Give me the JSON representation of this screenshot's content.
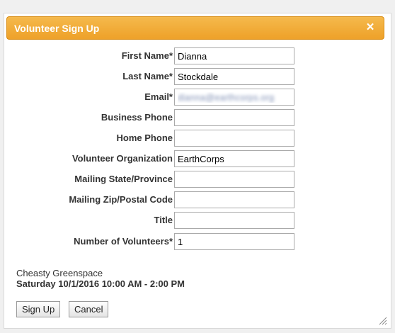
{
  "dialog": {
    "title": "Volunteer Sign Up",
    "close_glyph": "×",
    "icons": {
      "close": "close-icon",
      "resize": "resize-grip-icon"
    },
    "colors": {
      "titlebar": "#eea129",
      "title_text": "#ffffff"
    }
  },
  "form": {
    "first_name": {
      "label": "First Name*",
      "value": "Dianna"
    },
    "last_name": {
      "label": "Last Name*",
      "value": "Stockdale"
    },
    "email": {
      "label": "Email*",
      "value": "dianna@earthcorps.org"
    },
    "business_phone": {
      "label": "Business Phone",
      "value": ""
    },
    "home_phone": {
      "label": "Home Phone",
      "value": ""
    },
    "volunteer_organization": {
      "label": "Volunteer Organization",
      "value": "EarthCorps"
    },
    "mailing_state": {
      "label": "Mailing State/Province",
      "value": ""
    },
    "mailing_zip": {
      "label": "Mailing Zip/Postal Code",
      "value": ""
    },
    "title": {
      "label": "Title",
      "value": ""
    },
    "number_of_volunteers": {
      "label": "Number of Volunteers*",
      "value": "1"
    }
  },
  "event": {
    "name": "Cheasty Greenspace",
    "datetime": "Saturday 10/1/2016 10:00 AM - 2:00 PM"
  },
  "buttons": {
    "sign_up": "Sign Up",
    "cancel": "Cancel"
  }
}
